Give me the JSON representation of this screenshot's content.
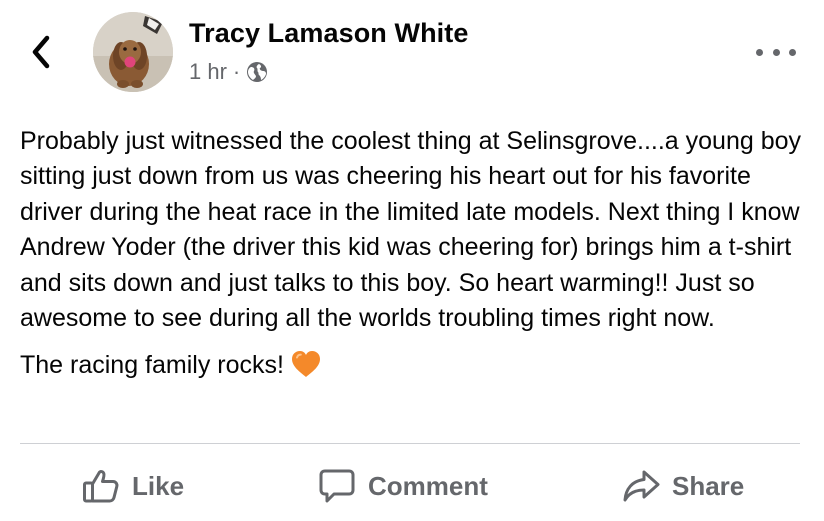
{
  "header": {
    "back_icon": "chevron-left-icon",
    "author_name": "Tracy Lamason White",
    "timestamp": "1 hr",
    "separator": "·",
    "audience_icon": "globe-icon",
    "more_icon": "more-horizontal-icon"
  },
  "post": {
    "body": "Probably just witnessed the coolest thing at Selinsgrove....a young boy sitting just down from us was cheering his heart out for his favorite driver during the heat race in the limited late models. Next thing I know Andrew Yoder (the driver this kid was cheering for) brings him a t-shirt and sits down and just talks to this boy. So heart warming!! Just so awesome to see during all the worlds troubling times right now.",
    "closing": "The racing family rocks!",
    "emoji": "orange-heart",
    "emoji_color": "#f4892a"
  },
  "actions": {
    "like_label": "Like",
    "comment_label": "Comment",
    "share_label": "Share"
  },
  "colors": {
    "text_primary": "#050505",
    "text_secondary": "#65676b",
    "divider": "#ced0d4"
  }
}
